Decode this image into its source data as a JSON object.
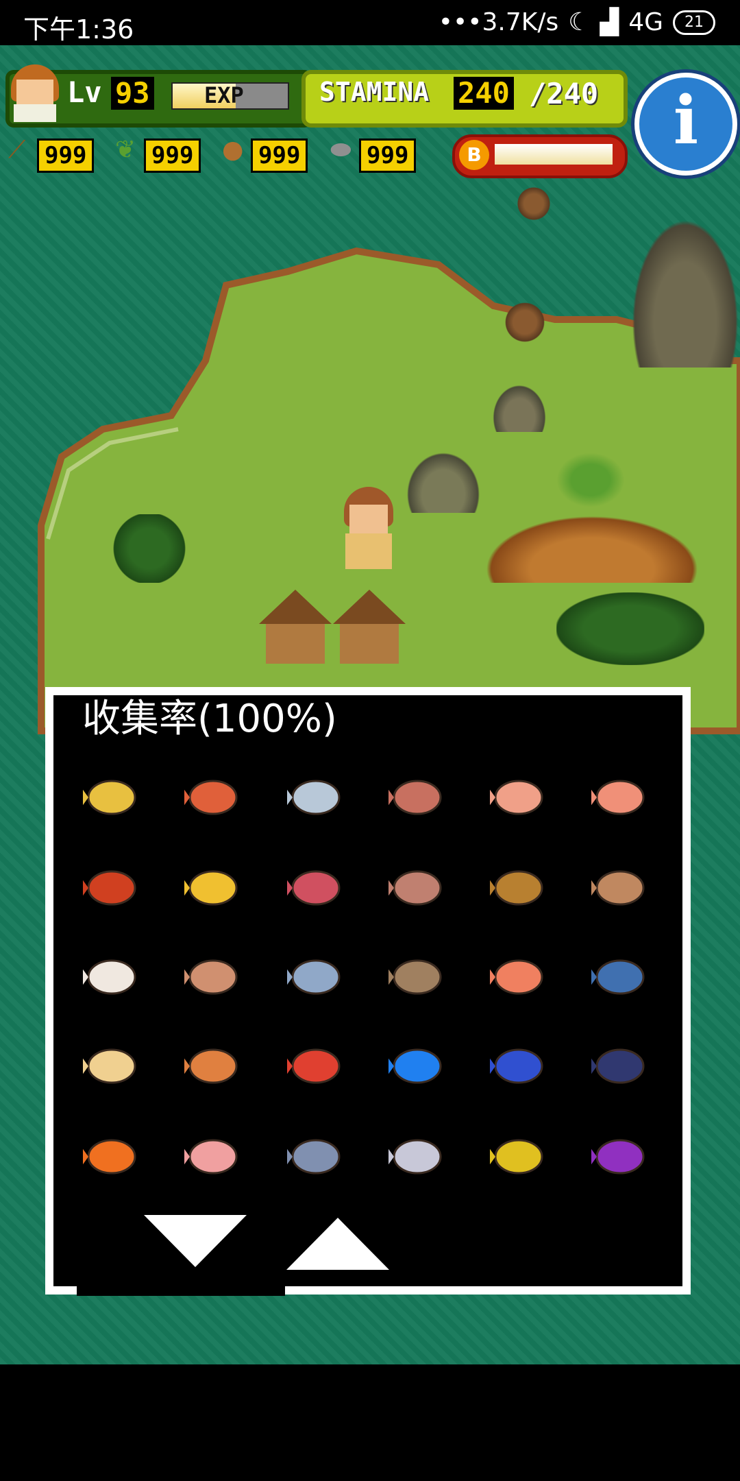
{
  "status_bar": {
    "time": "下午1:36",
    "network_speed": "•••3.7K/s",
    "network": "4G",
    "battery": "21"
  },
  "hud": {
    "level_label": "Lv",
    "level": "93",
    "exp_label": "EXP",
    "exp_fill": 0.55,
    "stamina_label": "STAMINA",
    "stamina": "240",
    "stamina_max": "/240",
    "info_icon": "info-icon"
  },
  "resources": [
    {
      "icon": "branch-icon",
      "value": "999"
    },
    {
      "icon": "leaf-icon",
      "value": "999"
    },
    {
      "icon": "nut-icon",
      "value": "999"
    },
    {
      "icon": "stone-icon",
      "value": "999"
    }
  ],
  "boost": {
    "label": "B",
    "fill": 1.0
  },
  "collection": {
    "title": "收集率(100%)",
    "items": [
      "shrimp-icon",
      "salmon-roe-icon",
      "silver-fish-icon",
      "salmon-icon",
      "crab-meat-icon",
      "pink-shrimp-icon",
      "red-shrimp-icon",
      "yellow-shrimp-icon",
      "red-crab-legs-icon",
      "fish-head-icon",
      "tuna-belly-icon",
      "brown-shrimp-icon",
      "scallop-sashimi-icon",
      "clam-icon",
      "sardine-icon",
      "flounder-icon",
      "pufferfish-icon",
      "tuna-icon",
      "squid-icon",
      "octopus-icon",
      "lobster-icon",
      "blue-fish-icon",
      "blue-tang-icon",
      "swordfish-icon",
      "clownfish-icon",
      "scallop-shell-icon",
      "mackerel-icon",
      "eel-icon",
      "yellow-perch-icon",
      "purple-fish-icon"
    ],
    "colors": {
      "shrimp-icon": "#e8c040",
      "salmon-roe-icon": "#e0603a",
      "silver-fish-icon": "#b8c8d8",
      "salmon-icon": "#c87060",
      "crab-meat-icon": "#f0a088",
      "pink-shrimp-icon": "#f09078",
      "red-shrimp-icon": "#d04020",
      "yellow-shrimp-icon": "#f0c030",
      "red-crab-legs-icon": "#d05060",
      "fish-head-icon": "#c08070",
      "tuna-belly-icon": "#b88030",
      "brown-shrimp-icon": "#c08860",
      "scallop-sashimi-icon": "#f0e8e0",
      "clam-icon": "#d09070",
      "sardine-icon": "#90a8c8",
      "flounder-icon": "#a08060",
      "pufferfish-icon": "#f08060",
      "tuna-icon": "#4070b0",
      "squid-icon": "#f0d090",
      "octopus-icon": "#e08040",
      "lobster-icon": "#e04030",
      "blue-fish-icon": "#2080f0",
      "blue-tang-icon": "#3050d0",
      "swordfish-icon": "#303870",
      "clownfish-icon": "#f07020",
      "scallop-shell-icon": "#f0a0a0",
      "mackerel-icon": "#8090b0",
      "eel-icon": "#c8c8d8",
      "yellow-perch-icon": "#e0c020",
      "purple-fish-icon": "#9030c0"
    }
  },
  "navigation": {
    "down_icon": "arrow-down-icon",
    "up_icon": "arrow-up-icon"
  }
}
